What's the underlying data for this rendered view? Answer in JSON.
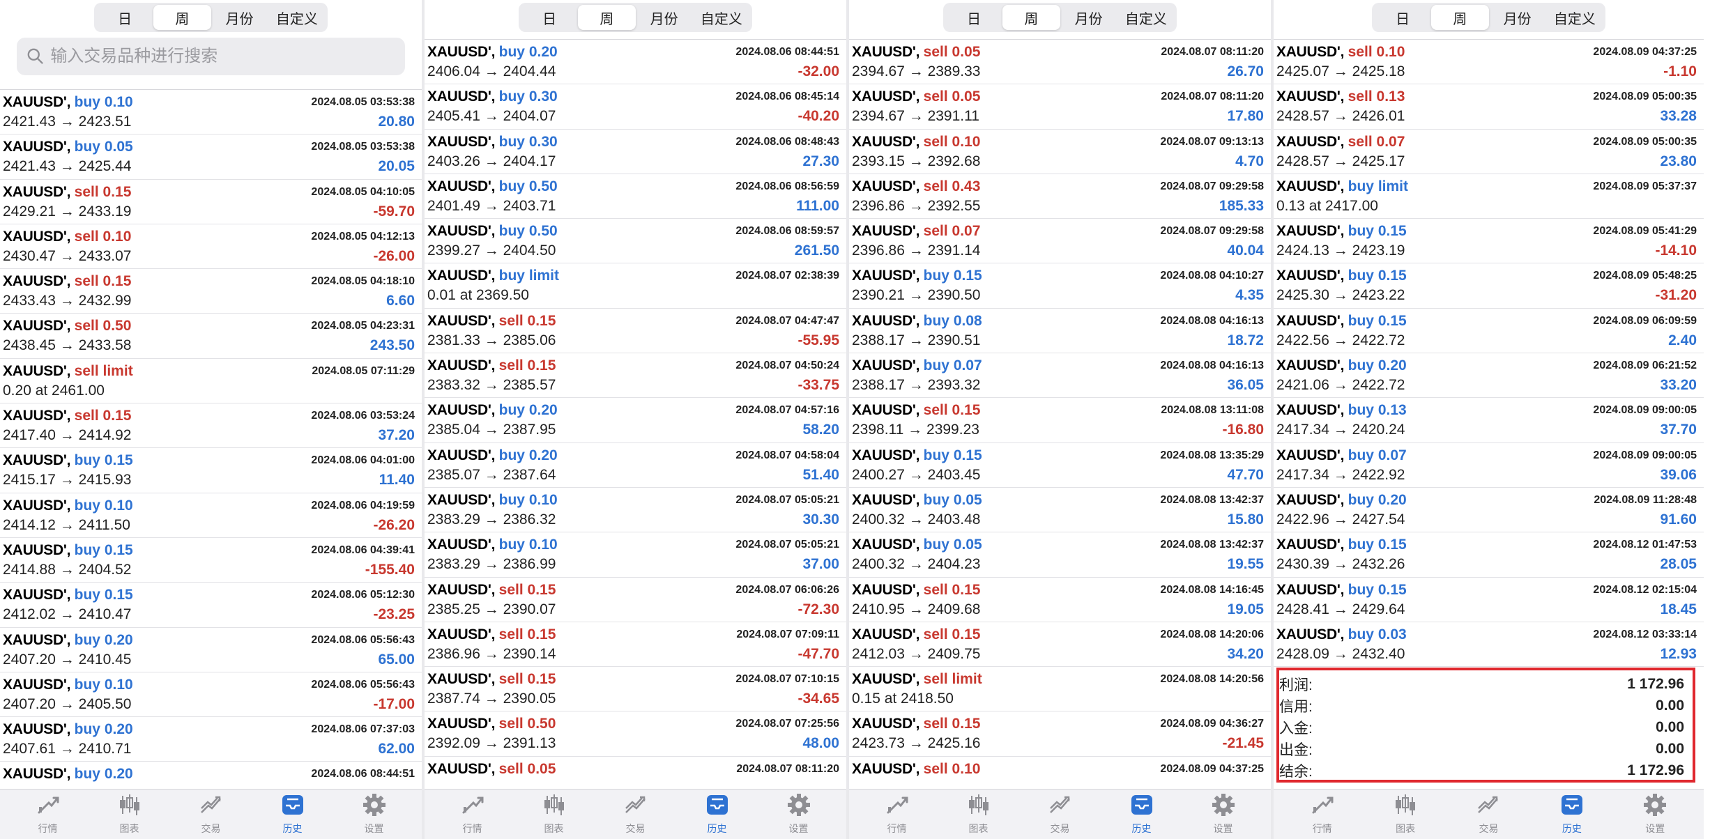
{
  "segments": [
    "日",
    "周",
    "月份",
    "自定义"
  ],
  "active_segment": "周",
  "search": {
    "placeholder": "输入交易品种进行搜索"
  },
  "tabs": [
    {
      "label": "行情",
      "icon": "quotes-icon"
    },
    {
      "label": "图表",
      "icon": "candlestick-chart-icon"
    },
    {
      "label": "交易",
      "icon": "trade-icon"
    },
    {
      "label": "历史",
      "icon": "history-inbox-icon"
    },
    {
      "label": "设置",
      "icon": "gear-icon"
    }
  ],
  "active_tab": "历史",
  "colors": {
    "buy": "#2e72d2",
    "sell": "#c8382f",
    "accent": "#2e72d2",
    "highlight_box": "#e0282e"
  },
  "panels": [
    {
      "rows": [
        {
          "symbol": "XAUUSD'",
          "side": "buy",
          "detail": "buy 0.10",
          "time": "2024.08.05 03:53:38",
          "prices": "2421.43 → 2423.51",
          "profit": "20.80"
        },
        {
          "symbol": "XAUUSD'",
          "side": "buy",
          "detail": "buy 0.05",
          "time": "2024.08.05 03:53:38",
          "prices": "2421.43 → 2425.44",
          "profit": "20.05"
        },
        {
          "symbol": "XAUUSD'",
          "side": "sell",
          "detail": "sell 0.15",
          "time": "2024.08.05 04:10:05",
          "prices": "2429.21 → 2433.19",
          "profit": "-59.70"
        },
        {
          "symbol": "XAUUSD'",
          "side": "sell",
          "detail": "sell 0.10",
          "time": "2024.08.05 04:12:13",
          "prices": "2430.47 → 2433.07",
          "profit": "-26.00"
        },
        {
          "symbol": "XAUUSD'",
          "side": "sell",
          "detail": "sell 0.15",
          "time": "2024.08.05 04:18:10",
          "prices": "2433.43 → 2432.99",
          "profit": "6.60"
        },
        {
          "symbol": "XAUUSD'",
          "side": "sell",
          "detail": "sell 0.50",
          "time": "2024.08.05 04:23:31",
          "prices": "2438.45 → 2433.58",
          "profit": "243.50"
        },
        {
          "symbol": "XAUUSD'",
          "side": "sell",
          "detail": "sell limit",
          "time": "2024.08.05 07:11:29",
          "prices": "0.20 at 2461.00",
          "profit": ""
        },
        {
          "symbol": "XAUUSD'",
          "side": "sell",
          "detail": "sell 0.15",
          "time": "2024.08.06 03:53:24",
          "prices": "2417.40 → 2414.92",
          "profit": "37.20"
        },
        {
          "symbol": "XAUUSD'",
          "side": "buy",
          "detail": "buy 0.15",
          "time": "2024.08.06 04:01:00",
          "prices": "2415.17 → 2415.93",
          "profit": "11.40"
        },
        {
          "symbol": "XAUUSD'",
          "side": "buy",
          "detail": "buy 0.10",
          "time": "2024.08.06 04:19:59",
          "prices": "2414.12 → 2411.50",
          "profit": "-26.20"
        },
        {
          "symbol": "XAUUSD'",
          "side": "buy",
          "detail": "buy 0.15",
          "time": "2024.08.06 04:39:41",
          "prices": "2414.88 → 2404.52",
          "profit": "-155.40"
        },
        {
          "symbol": "XAUUSD'",
          "side": "buy",
          "detail": "buy 0.15",
          "time": "2024.08.06 05:12:30",
          "prices": "2412.02 → 2410.47",
          "profit": "-23.25"
        },
        {
          "symbol": "XAUUSD'",
          "side": "buy",
          "detail": "buy 0.20",
          "time": "2024.08.06 05:56:43",
          "prices": "2407.20 → 2410.45",
          "profit": "65.00"
        },
        {
          "symbol": "XAUUSD'",
          "side": "buy",
          "detail": "buy 0.10",
          "time": "2024.08.06 05:56:43",
          "prices": "2407.20 → 2405.50",
          "profit": "-17.00"
        },
        {
          "symbol": "XAUUSD'",
          "side": "buy",
          "detail": "buy 0.20",
          "time": "2024.08.06 07:37:03",
          "prices": "2407.61 → 2410.71",
          "profit": "62.00"
        },
        {
          "symbol": "XAUUSD'",
          "side": "buy",
          "detail": "buy 0.20",
          "time": "2024.08.06 08:44:51",
          "prices": "",
          "profit": ""
        }
      ]
    },
    {
      "rows": [
        {
          "symbol": "XAUUSD'",
          "side": "buy",
          "detail": "buy 0.20",
          "time": "2024.08.06 08:44:51",
          "prices": "2406.04 → 2404.44",
          "profit": "-32.00"
        },
        {
          "symbol": "XAUUSD'",
          "side": "buy",
          "detail": "buy 0.30",
          "time": "2024.08.06 08:45:14",
          "prices": "2405.41 → 2404.07",
          "profit": "-40.20"
        },
        {
          "symbol": "XAUUSD'",
          "side": "buy",
          "detail": "buy 0.30",
          "time": "2024.08.06 08:48:43",
          "prices": "2403.26 → 2404.17",
          "profit": "27.30"
        },
        {
          "symbol": "XAUUSD'",
          "side": "buy",
          "detail": "buy 0.50",
          "time": "2024.08.06 08:56:59",
          "prices": "2401.49 → 2403.71",
          "profit": "111.00"
        },
        {
          "symbol": "XAUUSD'",
          "side": "buy",
          "detail": "buy 0.50",
          "time": "2024.08.06 08:59:57",
          "prices": "2399.27 → 2404.50",
          "profit": "261.50"
        },
        {
          "symbol": "XAUUSD'",
          "side": "buy",
          "detail": "buy limit",
          "time": "2024.08.07 02:38:39",
          "prices": "0.01 at 2369.50",
          "profit": ""
        },
        {
          "symbol": "XAUUSD'",
          "side": "sell",
          "detail": "sell 0.15",
          "time": "2024.08.07 04:47:47",
          "prices": "2381.33 → 2385.06",
          "profit": "-55.95"
        },
        {
          "symbol": "XAUUSD'",
          "side": "sell",
          "detail": "sell 0.15",
          "time": "2024.08.07 04:50:24",
          "prices": "2383.32 → 2385.57",
          "profit": "-33.75"
        },
        {
          "symbol": "XAUUSD'",
          "side": "buy",
          "detail": "buy 0.20",
          "time": "2024.08.07 04:57:16",
          "prices": "2385.04 → 2387.95",
          "profit": "58.20"
        },
        {
          "symbol": "XAUUSD'",
          "side": "buy",
          "detail": "buy 0.20",
          "time": "2024.08.07 04:58:04",
          "prices": "2385.07 → 2387.64",
          "profit": "51.40"
        },
        {
          "symbol": "XAUUSD'",
          "side": "buy",
          "detail": "buy 0.10",
          "time": "2024.08.07 05:05:21",
          "prices": "2383.29 → 2386.32",
          "profit": "30.30"
        },
        {
          "symbol": "XAUUSD'",
          "side": "buy",
          "detail": "buy 0.10",
          "time": "2024.08.07 05:05:21",
          "prices": "2383.29 → 2386.99",
          "profit": "37.00"
        },
        {
          "symbol": "XAUUSD'",
          "side": "sell",
          "detail": "sell 0.15",
          "time": "2024.08.07 06:06:26",
          "prices": "2385.25 → 2390.07",
          "profit": "-72.30"
        },
        {
          "symbol": "XAUUSD'",
          "side": "sell",
          "detail": "sell 0.15",
          "time": "2024.08.07 07:09:11",
          "prices": "2386.96 → 2390.14",
          "profit": "-47.70"
        },
        {
          "symbol": "XAUUSD'",
          "side": "sell",
          "detail": "sell 0.15",
          "time": "2024.08.07 07:10:15",
          "prices": "2387.74 → 2390.05",
          "profit": "-34.65"
        },
        {
          "symbol": "XAUUSD'",
          "side": "sell",
          "detail": "sell 0.50",
          "time": "2024.08.07 07:25:56",
          "prices": "2392.09 → 2391.13",
          "profit": "48.00"
        },
        {
          "symbol": "XAUUSD'",
          "side": "sell",
          "detail": "sell 0.05",
          "time": "2024.08.07 08:11:20",
          "prices": "",
          "profit": ""
        }
      ]
    },
    {
      "rows": [
        {
          "symbol": "XAUUSD'",
          "side": "sell",
          "detail": "sell 0.05",
          "time": "2024.08.07 08:11:20",
          "prices": "2394.67 → 2389.33",
          "profit": "26.70"
        },
        {
          "symbol": "XAUUSD'",
          "side": "sell",
          "detail": "sell 0.05",
          "time": "2024.08.07 08:11:20",
          "prices": "2394.67 → 2391.11",
          "profit": "17.80"
        },
        {
          "symbol": "XAUUSD'",
          "side": "sell",
          "detail": "sell 0.10",
          "time": "2024.08.07 09:13:13",
          "prices": "2393.15 → 2392.68",
          "profit": "4.70"
        },
        {
          "symbol": "XAUUSD'",
          "side": "sell",
          "detail": "sell 0.43",
          "time": "2024.08.07 09:29:58",
          "prices": "2396.86 → 2392.55",
          "profit": "185.33"
        },
        {
          "symbol": "XAUUSD'",
          "side": "sell",
          "detail": "sell 0.07",
          "time": "2024.08.07 09:29:58",
          "prices": "2396.86 → 2391.14",
          "profit": "40.04"
        },
        {
          "symbol": "XAUUSD'",
          "side": "buy",
          "detail": "buy 0.15",
          "time": "2024.08.08 04:10:27",
          "prices": "2390.21 → 2390.50",
          "profit": "4.35"
        },
        {
          "symbol": "XAUUSD'",
          "side": "buy",
          "detail": "buy 0.08",
          "time": "2024.08.08 04:16:13",
          "prices": "2388.17 → 2390.51",
          "profit": "18.72"
        },
        {
          "symbol": "XAUUSD'",
          "side": "buy",
          "detail": "buy 0.07",
          "time": "2024.08.08 04:16:13",
          "prices": "2388.17 → 2393.32",
          "profit": "36.05"
        },
        {
          "symbol": "XAUUSD'",
          "side": "sell",
          "detail": "sell 0.15",
          "time": "2024.08.08 13:11:08",
          "prices": "2398.11 → 2399.23",
          "profit": "-16.80"
        },
        {
          "symbol": "XAUUSD'",
          "side": "buy",
          "detail": "buy 0.15",
          "time": "2024.08.08 13:35:29",
          "prices": "2400.27 → 2403.45",
          "profit": "47.70"
        },
        {
          "symbol": "XAUUSD'",
          "side": "buy",
          "detail": "buy 0.05",
          "time": "2024.08.08 13:42:37",
          "prices": "2400.32 → 2403.48",
          "profit": "15.80"
        },
        {
          "symbol": "XAUUSD'",
          "side": "buy",
          "detail": "buy 0.05",
          "time": "2024.08.08 13:42:37",
          "prices": "2400.32 → 2404.23",
          "profit": "19.55"
        },
        {
          "symbol": "XAUUSD'",
          "side": "sell",
          "detail": "sell 0.15",
          "time": "2024.08.08 14:16:45",
          "prices": "2410.95 → 2409.68",
          "profit": "19.05"
        },
        {
          "symbol": "XAUUSD'",
          "side": "sell",
          "detail": "sell 0.15",
          "time": "2024.08.08 14:20:06",
          "prices": "2412.03 → 2409.75",
          "profit": "34.20"
        },
        {
          "symbol": "XAUUSD'",
          "side": "sell",
          "detail": "sell limit",
          "time": "2024.08.08 14:20:56",
          "prices": "0.15 at 2418.50",
          "profit": ""
        },
        {
          "symbol": "XAUUSD'",
          "side": "sell",
          "detail": "sell 0.15",
          "time": "2024.08.09 04:36:27",
          "prices": "2423.73 → 2425.16",
          "profit": "-21.45"
        },
        {
          "symbol": "XAUUSD'",
          "side": "sell",
          "detail": "sell 0.10",
          "time": "2024.08.09 04:37:25",
          "prices": "",
          "profit": ""
        }
      ]
    },
    {
      "rows": [
        {
          "symbol": "XAUUSD'",
          "side": "sell",
          "detail": "sell 0.10",
          "time": "2024.08.09 04:37:25",
          "prices": "2425.07 → 2425.18",
          "profit": "-1.10"
        },
        {
          "symbol": "XAUUSD'",
          "side": "sell",
          "detail": "sell 0.13",
          "time": "2024.08.09 05:00:35",
          "prices": "2428.57 → 2426.01",
          "profit": "33.28"
        },
        {
          "symbol": "XAUUSD'",
          "side": "sell",
          "detail": "sell 0.07",
          "time": "2024.08.09 05:00:35",
          "prices": "2428.57 → 2425.17",
          "profit": "23.80"
        },
        {
          "symbol": "XAUUSD'",
          "side": "buy",
          "detail": "buy limit",
          "time": "2024.08.09 05:37:37",
          "prices": "0.13 at 2417.00",
          "profit": ""
        },
        {
          "symbol": "XAUUSD'",
          "side": "buy",
          "detail": "buy 0.15",
          "time": "2024.08.09 05:41:29",
          "prices": "2424.13 → 2423.19",
          "profit": "-14.10"
        },
        {
          "symbol": "XAUUSD'",
          "side": "buy",
          "detail": "buy 0.15",
          "time": "2024.08.09 05:48:25",
          "prices": "2425.30 → 2423.22",
          "profit": "-31.20"
        },
        {
          "symbol": "XAUUSD'",
          "side": "buy",
          "detail": "buy 0.15",
          "time": "2024.08.09 06:09:59",
          "prices": "2422.56 → 2422.72",
          "profit": "2.40"
        },
        {
          "symbol": "XAUUSD'",
          "side": "buy",
          "detail": "buy 0.20",
          "time": "2024.08.09 06:21:52",
          "prices": "2421.06 → 2422.72",
          "profit": "33.20"
        },
        {
          "symbol": "XAUUSD'",
          "side": "buy",
          "detail": "buy 0.13",
          "time": "2024.08.09 09:00:05",
          "prices": "2417.34 → 2420.24",
          "profit": "37.70"
        },
        {
          "symbol": "XAUUSD'",
          "side": "buy",
          "detail": "buy 0.07",
          "time": "2024.08.09 09:00:05",
          "prices": "2417.34 → 2422.92",
          "profit": "39.06"
        },
        {
          "symbol": "XAUUSD'",
          "side": "buy",
          "detail": "buy 0.20",
          "time": "2024.08.09 11:28:48",
          "prices": "2422.96 → 2427.54",
          "profit": "91.60"
        },
        {
          "symbol": "XAUUSD'",
          "side": "buy",
          "detail": "buy 0.15",
          "time": "2024.08.12 01:47:53",
          "prices": "2430.39 → 2432.26",
          "profit": "28.05"
        },
        {
          "symbol": "XAUUSD'",
          "side": "buy",
          "detail": "buy 0.15",
          "time": "2024.08.12 02:15:04",
          "prices": "2428.41 → 2429.64",
          "profit": "18.45"
        },
        {
          "symbol": "XAUUSD'",
          "side": "buy",
          "detail": "buy 0.03",
          "time": "2024.08.12 03:33:14",
          "prices": "2428.09 → 2432.40",
          "profit": "12.93"
        }
      ],
      "summary": [
        {
          "label": "利润:",
          "value": "1 172.96"
        },
        {
          "label": "信用:",
          "value": "0.00"
        },
        {
          "label": "入金:",
          "value": "0.00"
        },
        {
          "label": "出金:",
          "value": "0.00"
        },
        {
          "label": "结余:",
          "value": "1 172.96"
        }
      ]
    }
  ]
}
